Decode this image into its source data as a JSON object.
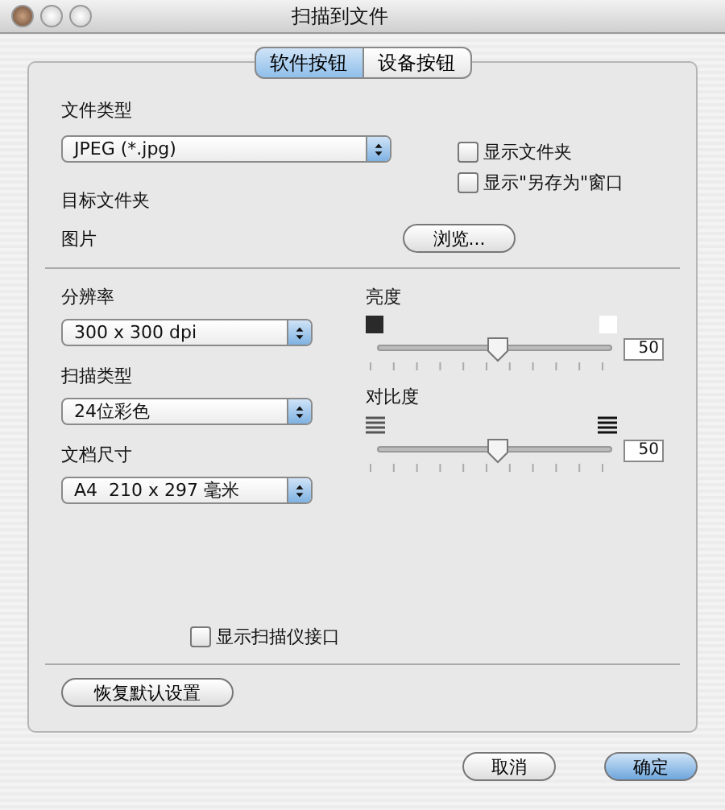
{
  "window": {
    "title": "扫描到文件"
  },
  "tabs": [
    {
      "label": "软件按钮",
      "selected": true
    },
    {
      "label": "设备按钮",
      "selected": false
    }
  ],
  "file_type": {
    "label": "文件类型",
    "value": "JPEG (*.jpg)"
  },
  "file_checkboxes": [
    {
      "label": "显示文件夹",
      "checked": false
    },
    {
      "label": "显示\"另存为\"窗口",
      "checked": false
    }
  ],
  "destination": {
    "label": "目标文件夹",
    "value": "图片",
    "button": "浏览..."
  },
  "popups": [
    {
      "label": "分辨率",
      "value": "300 x 300 dpi"
    },
    {
      "label": "扫描类型",
      "value": "24位彩色"
    },
    {
      "label": "文档尺寸",
      "value": "A4  210 x 297 毫米"
    }
  ],
  "sliders": [
    {
      "kind": "brightness",
      "label": "亮度",
      "level": 0.5,
      "reading": "50"
    },
    {
      "kind": "contrast",
      "label": "对比度",
      "level": 0.5,
      "reading": "50"
    }
  ],
  "scanner_interface": {
    "label": "显示扫描仪接口",
    "checked": false
  },
  "restore_button": "恢复默认设置",
  "buttons": [
    {
      "label": "取消",
      "default": false
    },
    {
      "label": "确定",
      "default": true
    }
  ]
}
